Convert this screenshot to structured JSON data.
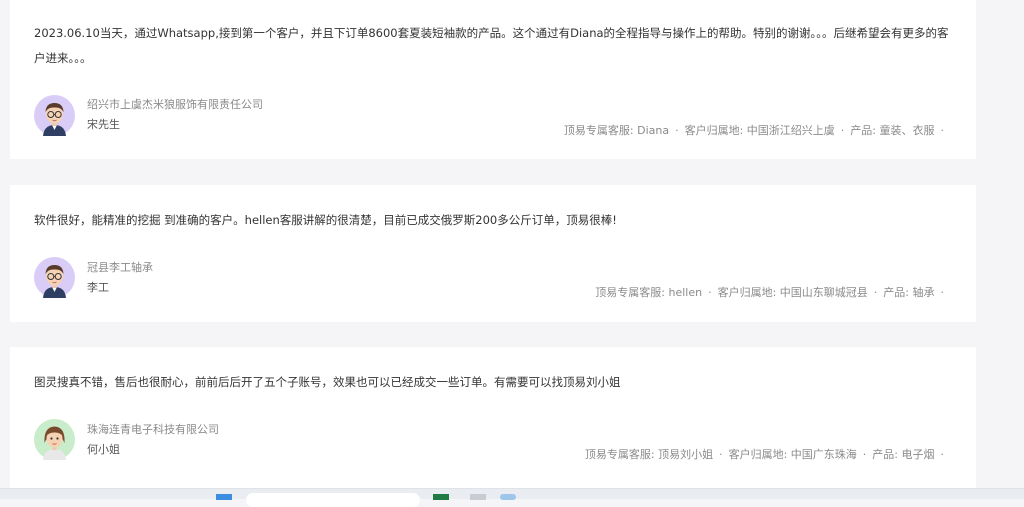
{
  "reviews": [
    {
      "text": "2023.06.10当天，通过Whatsapp,接到第一个客户，并且下订单8600套夏装短袖款的产品。这个通过有Diana的全程指导与操作上的帮助。特别的谢谢。。。后继希望会有更多的客户进来。。。",
      "company": "绍兴市上虞杰米狼服饰有限责任公司",
      "person": "宋先生",
      "service": "顶易专属客服: Diana",
      "location": "客户归属地: 中国浙江绍兴上虞",
      "product": "产品: 童装、衣服",
      "avatar": "male-glasses-avatar-icon"
    },
    {
      "text": "软件很好，能精准的挖掘 到准确的客户。hellen客服讲解的很清楚，目前已成交俄罗斯200多公斤订单，顶易很棒!",
      "company": "冠县李工轴承",
      "person": "李工",
      "service": "顶易专属客服: hellen",
      "location": "客户归属地: 中国山东聊城冠县",
      "product": "产品: 轴承",
      "avatar": "male-glasses-avatar-icon"
    },
    {
      "text": "图灵搜真不错，售后也很耐心，前前后后开了五个子账号，效果也可以已经成交一些订单。有需要可以找顶易刘小姐",
      "company": "珠海连青电子科技有限公司",
      "person": "何小姐",
      "service": "顶易专属客服: 顶易刘小姐",
      "location": "客户归属地: 中国广东珠海",
      "product": "产品: 电子烟",
      "avatar": "female-avatar-icon"
    }
  ],
  "separator": "·",
  "colors": {
    "background": "#f5f5f7",
    "card": "#ffffff",
    "avatar_purple": "#d9ccf7",
    "avatar_green": "#c9eccb"
  }
}
